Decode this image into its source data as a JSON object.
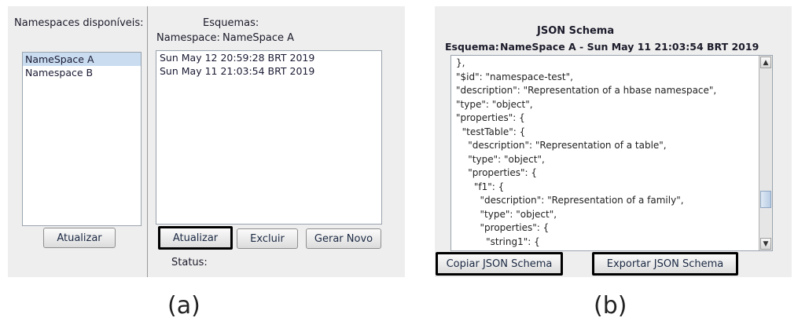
{
  "panel_a": {
    "namespaces_label": "Namespaces disponíveis:",
    "namespaces": [
      "NameSpace A",
      "Namespace B"
    ],
    "update_left_label": "Atualizar",
    "schemas_title": "Esquemas:",
    "namespace_prefix": "Namespace:",
    "namespace_value": "NameSpace A",
    "schemas": [
      "Sun May 12 20:59:28 BRT 2019",
      "Sun May 11 21:03:54 BRT 2019"
    ],
    "update_label": "Atualizar",
    "delete_label": "Excluir",
    "generate_label": "Gerar Novo",
    "status_label": "Status:"
  },
  "panel_b": {
    "title": "JSON Schema",
    "schema_prefix": "Esquema:",
    "schema_value": "NameSpace A - Sun May 11 21:03:54 BRT 2019",
    "code_lines": [
      "},",
      "\"$id\": \"namespace-test\",",
      "\"description\": \"Representation of a hbase namespace\",",
      "\"type\": \"object\",",
      "\"properties\": {",
      "  \"testTable\": {",
      "    \"description\": \"Representation of a table\",",
      "    \"type\": \"object\",",
      "    \"properties\": {",
      "      \"f1\": {",
      "        \"description\": \"Representation of a family\",",
      "        \"type\": \"object\",",
      "        \"properties\": {",
      "          \"string1\": {"
    ],
    "copy_label": "Copiar JSON Schema",
    "export_label": "Exportar JSON Schema"
  },
  "captions": {
    "a": "(a)",
    "b": "(b)"
  }
}
